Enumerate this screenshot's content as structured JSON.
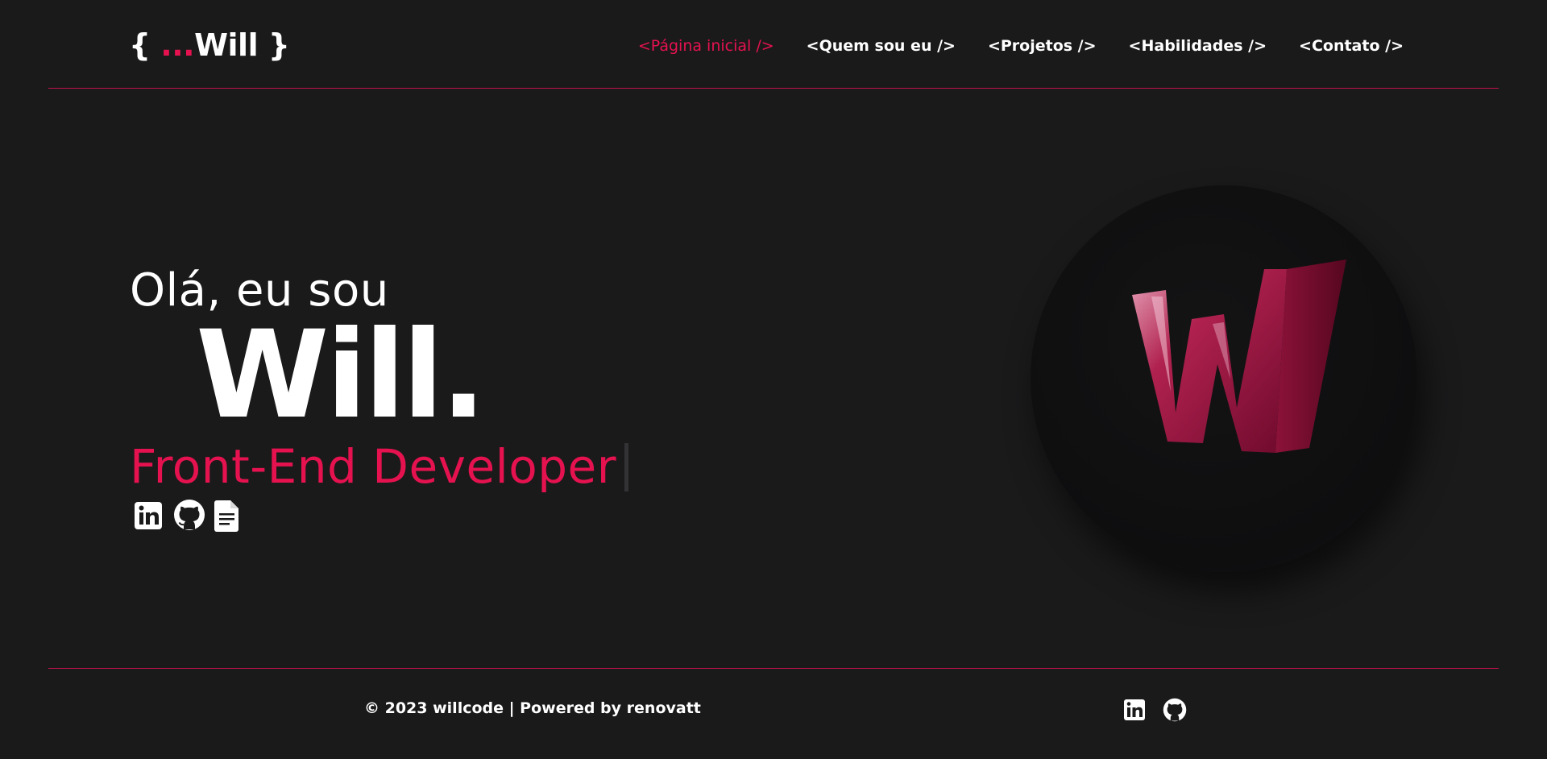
{
  "header": {
    "logo_open": "{ ",
    "logo_dots": "...",
    "logo_name": "Will",
    "logo_close": " }",
    "nav": [
      {
        "label": "<Página inicial />",
        "active": true
      },
      {
        "label": "<Quem sou eu />",
        "active": false
      },
      {
        "label": "<Projetos />",
        "active": false
      },
      {
        "label": "<Habilidades />",
        "active": false
      },
      {
        "label": "<Contato />",
        "active": false
      }
    ]
  },
  "hero": {
    "greeting": "Olá, eu sou",
    "name": "Will.",
    "role": "Front-End Developer",
    "icons": [
      "linkedin-icon",
      "github-icon",
      "document-icon"
    ],
    "avatar_letter": "W"
  },
  "footer": {
    "copyright": "© 2023 willcode | Powered by renovatt",
    "icons": [
      "linkedin-icon",
      "github-icon"
    ]
  },
  "colors": {
    "accent": "#e5124f",
    "background": "#1a1a1b",
    "text": "#ffffff"
  }
}
